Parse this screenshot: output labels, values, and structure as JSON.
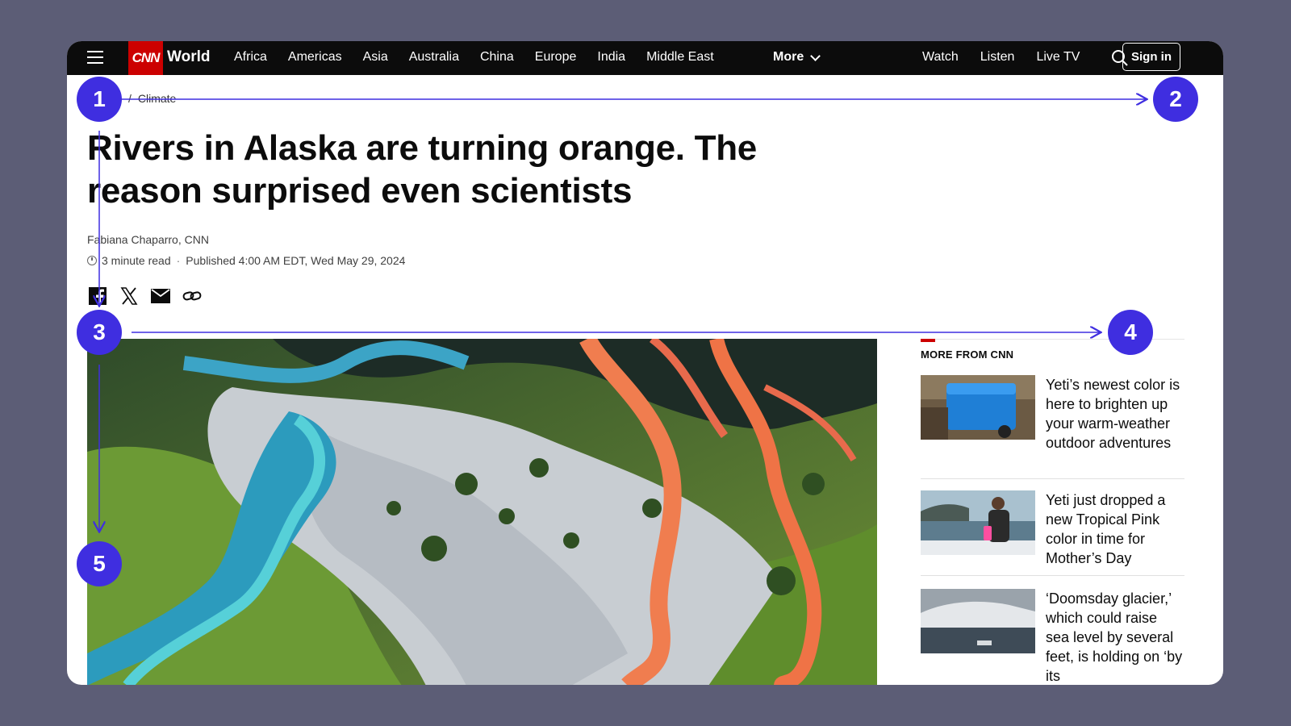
{
  "nav": {
    "logo": "CNN",
    "section": "World",
    "links": [
      "Africa",
      "Americas",
      "Asia",
      "Australia",
      "China",
      "Europe",
      "India",
      "Middle East"
    ],
    "more_label": "More",
    "right_links": [
      "Watch",
      "Listen",
      "Live TV"
    ],
    "sign_in": "Sign in"
  },
  "breadcrumb": {
    "sep": "/",
    "item": "Climate"
  },
  "article": {
    "headline": "Rivers in Alaska are turning orange. The reason surprised even scientists",
    "byline": "Fabiana Chaparro, CNN",
    "read_time": "3 minute read",
    "dot": "·",
    "published": "Published 4:00 AM EDT, Wed May 29, 2024"
  },
  "share_icons": [
    "facebook-icon",
    "x-icon",
    "email-icon",
    "link-icon"
  ],
  "sidebar": {
    "title": "MORE FROM CNN",
    "items": [
      {
        "text": "Yeti’s newest color is here to brighten up your warm-weather outdoor adventures"
      },
      {
        "text": "Yeti just dropped a new Tropical Pink color in time for Mother’s Day"
      },
      {
        "text": "‘Doomsday glacier,’ which could raise sea level by several feet, is holding on ‘by its"
      }
    ]
  },
  "annotations": [
    "1",
    "2",
    "3",
    "4",
    "5"
  ],
  "colors": {
    "accent": "#cc0000",
    "annotation": "#3f2ee0",
    "nav_bg": "#0c0c0c",
    "backdrop": "#5c5d76"
  }
}
